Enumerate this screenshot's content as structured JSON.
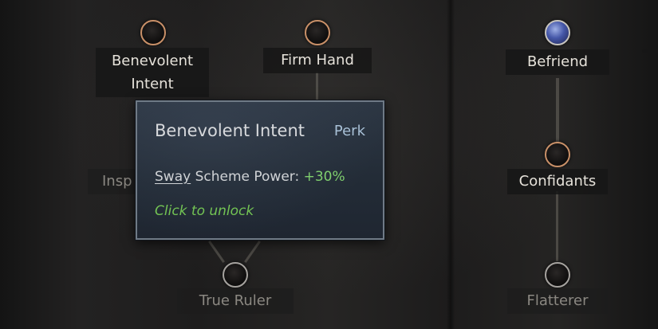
{
  "perks": {
    "benevolent_intent": "Benevolent\nIntent",
    "firm_hand": "Firm Hand",
    "befriend": "Befriend",
    "confidants": "Confidants",
    "inspiring_partial": "Insp",
    "true_ruler": "True Ruler",
    "flatterer": "Flatterer"
  },
  "tooltip": {
    "title": "Benevolent Intent",
    "kind": "Perk",
    "effect_keyword": "Sway",
    "effect_text": "Scheme Power:",
    "effect_value": "+30%",
    "action": "Click to unlock"
  },
  "colors": {
    "available_ring": "#c99068",
    "locked_ring": "#a6a39f",
    "unlocked_gem": "#4557a8",
    "positive_value": "#7fcf6e",
    "action_text": "#73c454"
  }
}
